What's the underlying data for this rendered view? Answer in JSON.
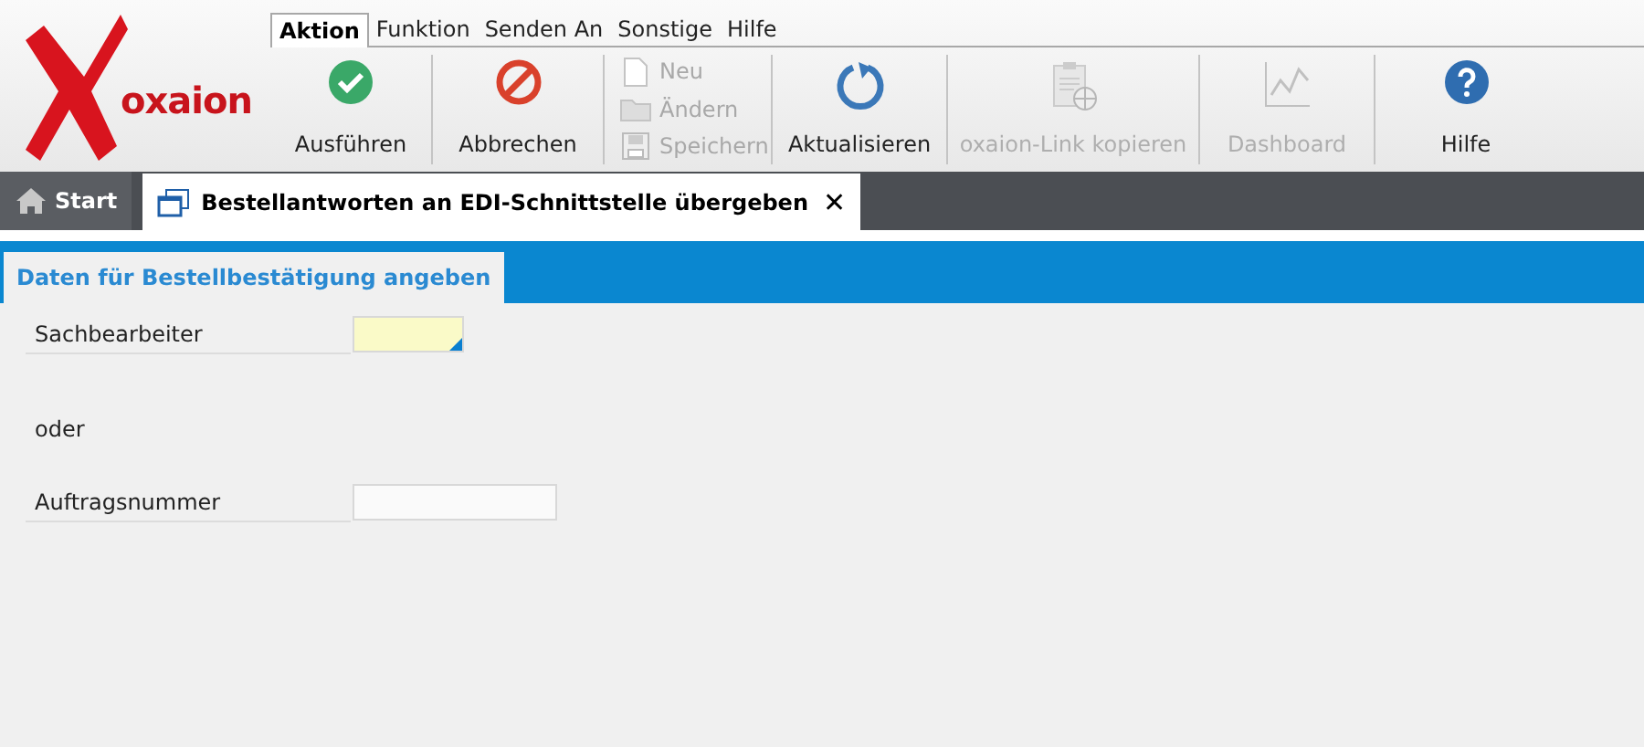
{
  "logo": {
    "text": "oxaion"
  },
  "menu_tabs": [
    {
      "label": "Aktion",
      "selected": true
    },
    {
      "label": "Funktion",
      "selected": false
    },
    {
      "label": "Senden An",
      "selected": false
    },
    {
      "label": "Sonstige",
      "selected": false
    },
    {
      "label": "Hilfe",
      "selected": false
    }
  ],
  "toolbar": [
    {
      "kind": "large",
      "label": "Ausführen",
      "disabled": false
    },
    {
      "kind": "large",
      "label": "Abbrechen",
      "disabled": false
    },
    {
      "kind": "stack",
      "items": [
        {
          "label": "Neu",
          "disabled": true
        },
        {
          "label": "Ändern",
          "disabled": true
        },
        {
          "label": "Speichern",
          "disabled": true
        }
      ]
    },
    {
      "kind": "large",
      "label": "Aktualisieren",
      "disabled": false
    },
    {
      "kind": "large",
      "label": "oxaion-Link kopieren",
      "disabled": true
    },
    {
      "kind": "large",
      "label": "Dashboard",
      "disabled": true
    },
    {
      "kind": "large",
      "label": "Hilfe",
      "disabled": false
    }
  ],
  "window_tabs": [
    {
      "label": "Start",
      "selected": false
    },
    {
      "label": "Bestellantworten an EDI-Schnittstelle übergeben",
      "selected": true,
      "close": "✕"
    }
  ],
  "section_tab": {
    "label": "Daten für Bestellbestätigung angeben"
  },
  "form": [
    {
      "kind": "field",
      "label": "Sachbearbeiter",
      "required": true
    },
    {
      "kind": "text",
      "label": "oder"
    },
    {
      "kind": "field",
      "label": "Auftragsnummer",
      "required": false
    }
  ]
}
